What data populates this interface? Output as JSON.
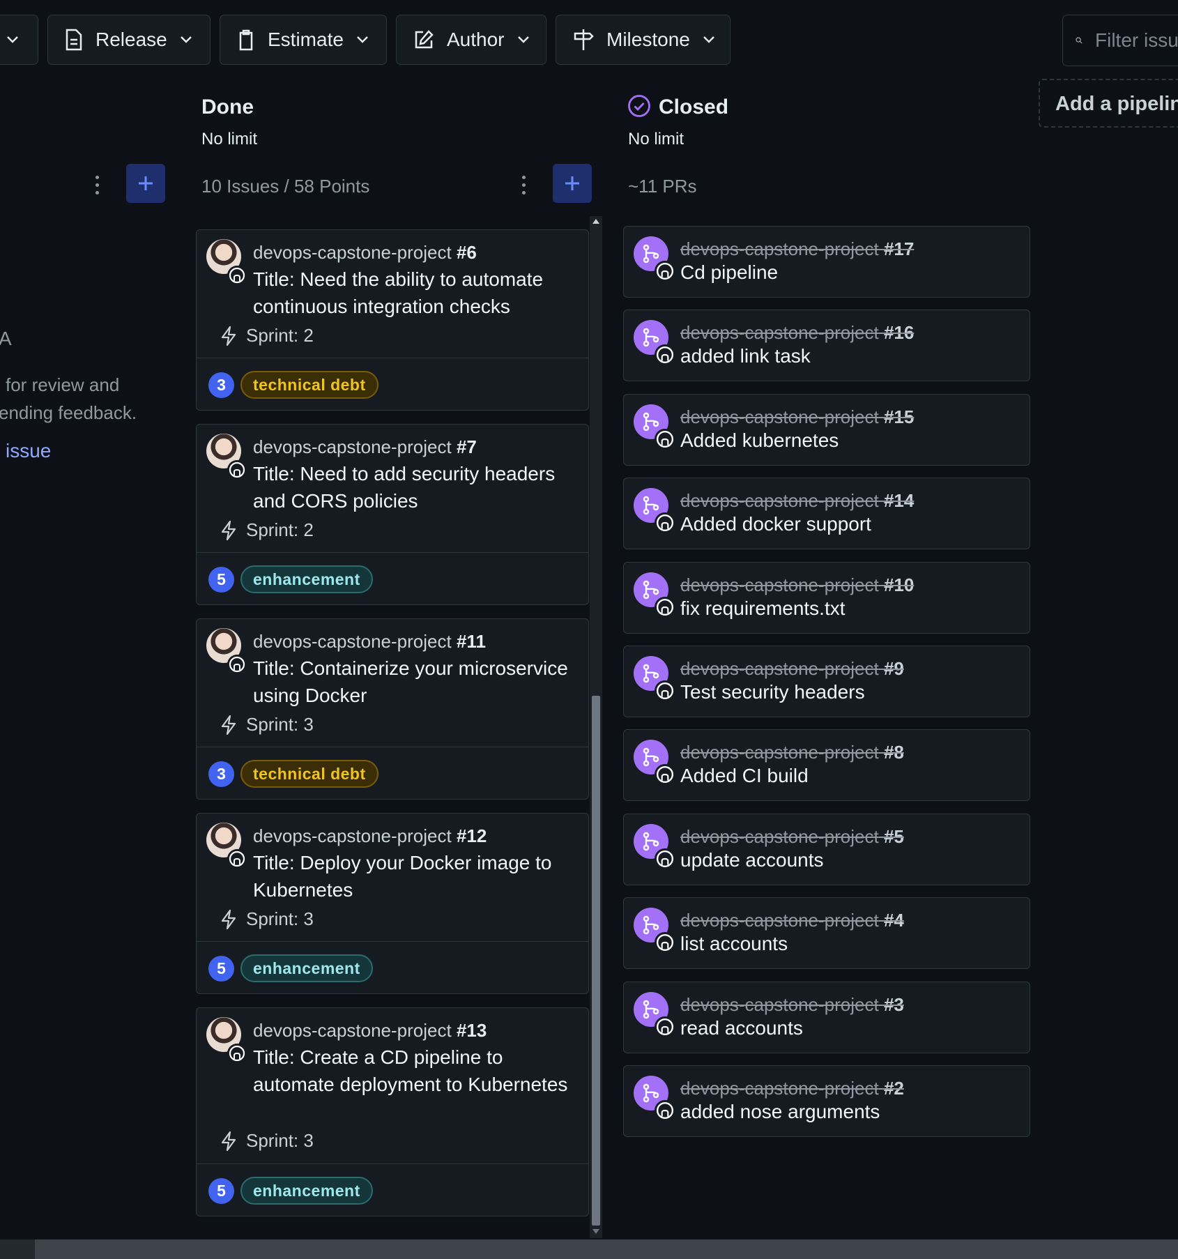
{
  "toolbar": {
    "filters": [
      {
        "label": "Release",
        "icon": "file-icon"
      },
      {
        "label": "Estimate",
        "icon": "clipboard-icon"
      },
      {
        "label": "Author",
        "icon": "pencil-square-icon"
      },
      {
        "label": "Milestone",
        "icon": "signpost-icon"
      }
    ],
    "search_placeholder": "Filter issu"
  },
  "add_pipeline": "Add a pipelin",
  "left_column": {
    "heading_fragment": "A",
    "description_line1": "for review and",
    "description_line2": "ending feedback.",
    "link_fragment": "issue"
  },
  "done": {
    "title": "Done",
    "limit": "No limit",
    "count": "10 Issues / 58 Points",
    "cards": [
      {
        "repo": "devops-capstone-project",
        "number": "#6",
        "title": "Title: Need the ability to automate continuous integration checks",
        "sprint": "Sprint: 2",
        "points": "3",
        "label": "technical debt",
        "label_type": "td"
      },
      {
        "repo": "devops-capstone-project",
        "number": "#7",
        "title": "Title: Need to add security headers and CORS policies",
        "sprint": "Sprint: 2",
        "points": "5",
        "label": "enhancement",
        "label_type": "enh"
      },
      {
        "repo": "devops-capstone-project",
        "number": "#11",
        "title": "Title: Containerize your microservice using Docker",
        "sprint": "Sprint: 3",
        "points": "3",
        "label": "technical debt",
        "label_type": "td"
      },
      {
        "repo": "devops-capstone-project",
        "number": "#12",
        "title": "Title: Deploy your Docker image to Kubernetes",
        "sprint": "Sprint: 3",
        "points": "5",
        "label": "enhancement",
        "label_type": "enh"
      },
      {
        "repo": "devops-capstone-project",
        "number": "#13",
        "title": "Title: Create a CD pipeline to automate deployment to Kubernetes",
        "sprint": "Sprint: 3",
        "points": "5",
        "label": "enhancement",
        "label_type": "enh"
      }
    ]
  },
  "closed": {
    "title": "Closed",
    "limit": "No limit",
    "count": "~11 PRs",
    "prs": [
      {
        "repo": "devops-capstone-project",
        "number": "#17",
        "title": "Cd pipeline"
      },
      {
        "repo": "devops-capstone-project",
        "number": "#16",
        "title": "added link task"
      },
      {
        "repo": "devops-capstone-project",
        "number": "#15",
        "title": "Added kubernetes"
      },
      {
        "repo": "devops-capstone-project",
        "number": "#14",
        "title": "Added docker support"
      },
      {
        "repo": "devops-capstone-project",
        "number": "#10",
        "title": "fix requirements.txt"
      },
      {
        "repo": "devops-capstone-project",
        "number": "#9",
        "title": "Test security headers"
      },
      {
        "repo": "devops-capstone-project",
        "number": "#8",
        "title": "Added CI build"
      },
      {
        "repo": "devops-capstone-project",
        "number": "#5",
        "title": "update accounts"
      },
      {
        "repo": "devops-capstone-project",
        "number": "#4",
        "title": "list accounts"
      },
      {
        "repo": "devops-capstone-project",
        "number": "#3",
        "title": "read accounts"
      },
      {
        "repo": "devops-capstone-project",
        "number": "#2",
        "title": "added nose arguments"
      }
    ]
  },
  "colors": {
    "background": "#0d1117",
    "card": "#161b22",
    "border": "#30363d",
    "accent_blue": "#4163f0",
    "pr_purple": "#a371f7",
    "label_td": "#f0c420",
    "label_enh": "#9ee7ec"
  }
}
